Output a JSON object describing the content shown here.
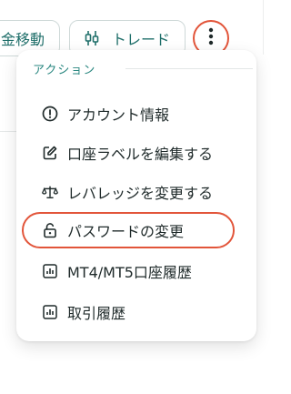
{
  "toolbar": {
    "transfer_label": "金移動",
    "trade_label": "トレード",
    "colors": {
      "accent": "#1f6f6a",
      "highlight": "#e2553a"
    }
  },
  "menu": {
    "header": "アクション",
    "items": [
      {
        "label": "アカウント情報",
        "icon": "info-circle-icon"
      },
      {
        "label": "口座ラベルを編集する",
        "icon": "edit-icon"
      },
      {
        "label": "レバレッジを変更する",
        "icon": "scale-icon"
      },
      {
        "label": "パスワードの変更",
        "icon": "lock-icon",
        "highlighted": true
      },
      {
        "label": "MT4/MT5口座履歴",
        "icon": "chart-icon"
      },
      {
        "label": "取引履歴",
        "icon": "chart-icon"
      }
    ]
  }
}
